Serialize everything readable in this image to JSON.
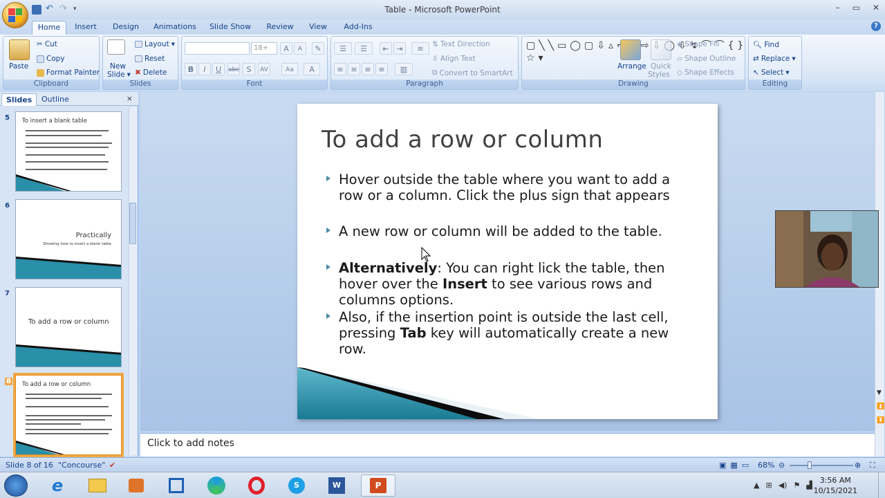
{
  "window": {
    "title": "Table - Microsoft PowerPoint"
  },
  "tabs": [
    "Home",
    "Insert",
    "Design",
    "Animations",
    "Slide Show",
    "Review",
    "View",
    "Add-Ins"
  ],
  "ribbon": {
    "clipboard": {
      "label": "Clipboard",
      "paste": "Paste",
      "cut": "Cut",
      "copy": "Copy",
      "format_painter": "Format Painter"
    },
    "slides": {
      "label": "Slides",
      "new_slide": "New",
      "new_slide2": "Slide",
      "layout": "Layout",
      "reset": "Reset",
      "delete": "Delete"
    },
    "font": {
      "label": "Font",
      "font_size": "18+"
    },
    "paragraph": {
      "label": "Paragraph",
      "text_direction": "Text Direction",
      "align_text": "Align Text",
      "convert": "Convert to SmartArt"
    },
    "drawing": {
      "label": "Drawing",
      "arrange": "Arrange",
      "quick_styles": "Quick",
      "quick_styles2": "Styles",
      "shape_fill": "Shape Fill",
      "shape_outline": "Shape Outline",
      "shape_effects": "Shape Effects"
    },
    "editing": {
      "label": "Editing",
      "find": "Find",
      "replace": "Replace",
      "select": "Select"
    }
  },
  "pane": {
    "tab_slides": "Slides",
    "tab_outline": "Outline"
  },
  "thumbnails": [
    {
      "num": "5",
      "title": "To insert a blank table"
    },
    {
      "num": "6",
      "title": "Practically",
      "subtitle": "Showing how to insert a blank table"
    },
    {
      "num": "7",
      "title": "To add a row or column"
    },
    {
      "num": "8",
      "title": "To add a row or column"
    }
  ],
  "slide": {
    "title": "To add a row or column",
    "b1": "Hover outside the table where you want to add a row or a column. Click the plus sign that appears",
    "b2": "A new row or column will be added to the table.",
    "b3_bold": "Alternatively",
    "b3_a": ": You can right lick the table, then hover over the ",
    "b3_bold2": "Insert",
    "b3_b": "  to see various rows and columns options.",
    "b4_a": "Also, if the insertion point is outside the last cell, pressing ",
    "b4_bold": "Tab",
    "b4_b": " key will automatically create a new row."
  },
  "notes": {
    "placeholder": "Click to add notes"
  },
  "status": {
    "slide": "Slide 8 of 16",
    "theme": "\"Concourse\"",
    "zoom": "68%"
  },
  "clock": {
    "time": "3:56 AM",
    "date": "10/15/2021"
  },
  "colors": {
    "accent": "#2a8fa8",
    "ribbon": "#dbe7f6"
  }
}
